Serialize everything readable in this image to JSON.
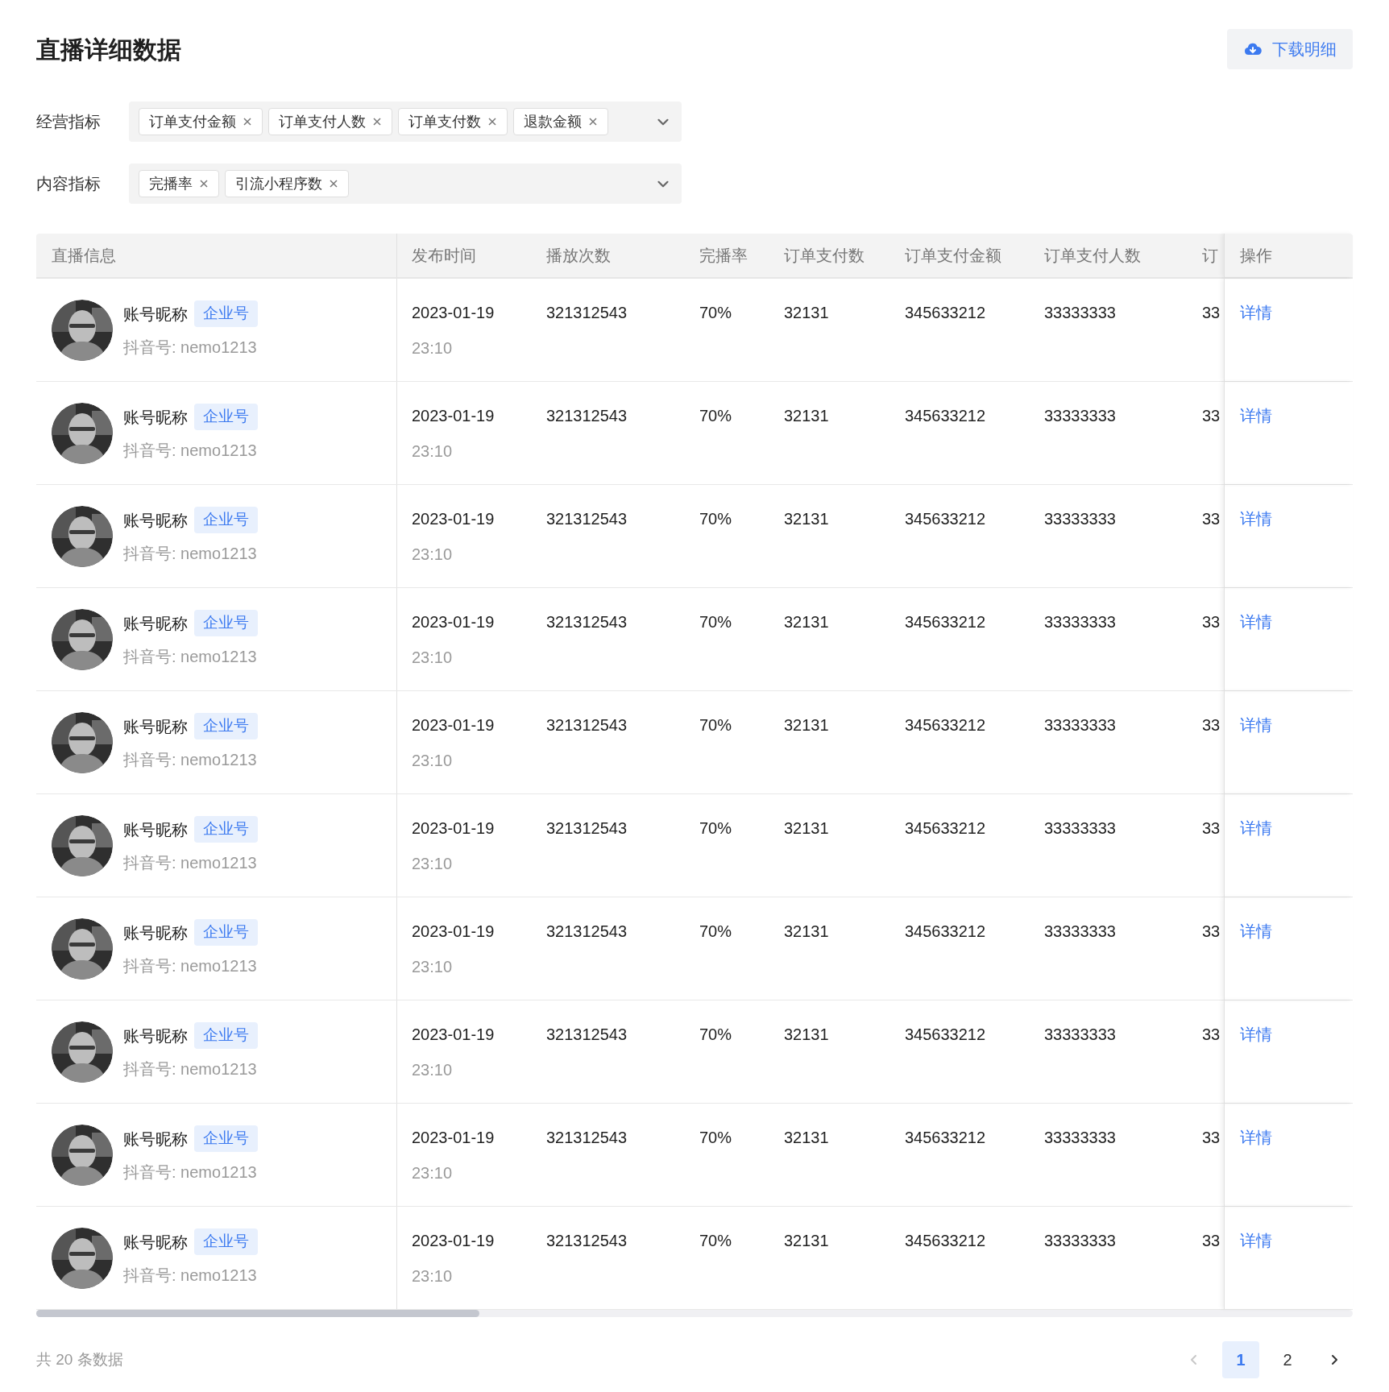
{
  "title": "直播详细数据",
  "download_button": {
    "label": "下载明细"
  },
  "filters": [
    {
      "label": "经营指标",
      "tags": [
        "订单支付金额",
        "订单支付人数",
        "订单支付数",
        "退款金额"
      ]
    },
    {
      "label": "内容指标",
      "tags": [
        "完播率",
        "引流小程序数"
      ]
    }
  ],
  "table": {
    "columns": [
      "直播信息",
      "发布时间",
      "播放次数",
      "完播率",
      "订单支付数",
      "订单支付金额",
      "订单支付人数",
      "订",
      "操作"
    ],
    "rows": [
      {
        "nickname": "账号昵称",
        "badge": "企业号",
        "account": "抖音号: nemo1213",
        "date": "2023-01-19",
        "time": "23:10",
        "plays": "321312543",
        "completion": "70%",
        "orders": "32131",
        "amount": "345633212",
        "buyers": "33333333",
        "column_8": "33",
        "action": "详情"
      },
      {
        "nickname": "账号昵称",
        "badge": "企业号",
        "account": "抖音号: nemo1213",
        "date": "2023-01-19",
        "time": "23:10",
        "plays": "321312543",
        "completion": "70%",
        "orders": "32131",
        "amount": "345633212",
        "buyers": "33333333",
        "column_8": "33",
        "action": "详情"
      },
      {
        "nickname": "账号昵称",
        "badge": "企业号",
        "account": "抖音号: nemo1213",
        "date": "2023-01-19",
        "time": "23:10",
        "plays": "321312543",
        "completion": "70%",
        "orders": "32131",
        "amount": "345633212",
        "buyers": "33333333",
        "column_8": "33",
        "action": "详情"
      },
      {
        "nickname": "账号昵称",
        "badge": "企业号",
        "account": "抖音号: nemo1213",
        "date": "2023-01-19",
        "time": "23:10",
        "plays": "321312543",
        "completion": "70%",
        "orders": "32131",
        "amount": "345633212",
        "buyers": "33333333",
        "column_8": "33",
        "action": "详情"
      },
      {
        "nickname": "账号昵称",
        "badge": "企业号",
        "account": "抖音号: nemo1213",
        "date": "2023-01-19",
        "time": "23:10",
        "plays": "321312543",
        "completion": "70%",
        "orders": "32131",
        "amount": "345633212",
        "buyers": "33333333",
        "column_8": "33",
        "action": "详情"
      },
      {
        "nickname": "账号昵称",
        "badge": "企业号",
        "account": "抖音号: nemo1213",
        "date": "2023-01-19",
        "time": "23:10",
        "plays": "321312543",
        "completion": "70%",
        "orders": "32131",
        "amount": "345633212",
        "buyers": "33333333",
        "column_8": "33",
        "action": "详情"
      },
      {
        "nickname": "账号昵称",
        "badge": "企业号",
        "account": "抖音号: nemo1213",
        "date": "2023-01-19",
        "time": "23:10",
        "plays": "321312543",
        "completion": "70%",
        "orders": "32131",
        "amount": "345633212",
        "buyers": "33333333",
        "column_8": "33",
        "action": "详情"
      },
      {
        "nickname": "账号昵称",
        "badge": "企业号",
        "account": "抖音号: nemo1213",
        "date": "2023-01-19",
        "time": "23:10",
        "plays": "321312543",
        "completion": "70%",
        "orders": "32131",
        "amount": "345633212",
        "buyers": "33333333",
        "column_8": "33",
        "action": "详情"
      },
      {
        "nickname": "账号昵称",
        "badge": "企业号",
        "account": "抖音号: nemo1213",
        "date": "2023-01-19",
        "time": "23:10",
        "plays": "321312543",
        "completion": "70%",
        "orders": "32131",
        "amount": "345633212",
        "buyers": "33333333",
        "column_8": "33",
        "action": "详情"
      },
      {
        "nickname": "账号昵称",
        "badge": "企业号",
        "account": "抖音号: nemo1213",
        "date": "2023-01-19",
        "time": "23:10",
        "plays": "321312543",
        "completion": "70%",
        "orders": "32131",
        "amount": "345633212",
        "buyers": "33333333",
        "column_8": "33",
        "action": "详情"
      }
    ]
  },
  "footer": {
    "total": "共 20 条数据",
    "pages": [
      {
        "label": "1",
        "selected": true
      },
      {
        "label": "2",
        "selected": false
      }
    ],
    "prev_disabled": true,
    "next_disabled": false
  }
}
